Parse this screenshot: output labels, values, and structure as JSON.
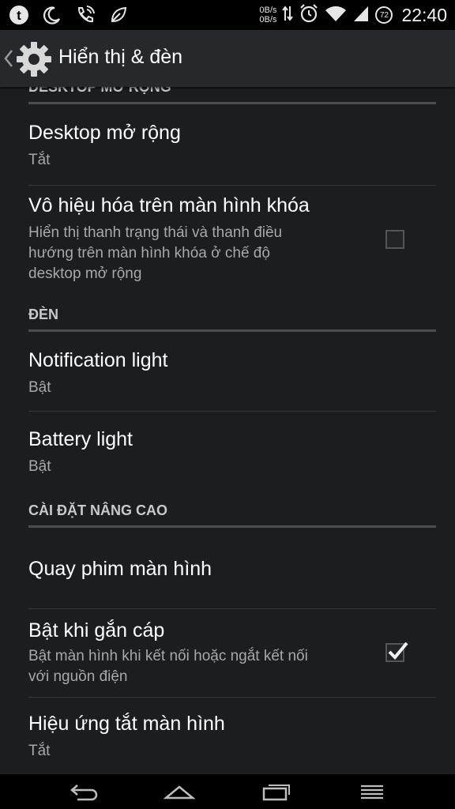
{
  "status_bar": {
    "icons_left": [
      "tumblr-icon",
      "moon-icon",
      "phone-call-icon",
      "leaf-icon"
    ],
    "net_up": "0B/s",
    "net_down": "0B/s",
    "battery_level": "72",
    "time": "22:40"
  },
  "action_bar": {
    "title": "Hiển thị & đèn"
  },
  "sections": {
    "partial_header": "DESKTOP MỞ RỘNG",
    "lights_header": "ĐÈN",
    "advanced_header": "CÀI ĐẶT NÂNG CAO"
  },
  "items": {
    "desktop": {
      "title": "Desktop mở rộng",
      "summary": "Tắt"
    },
    "lockscreen": {
      "title": "Vô hiệu hóa trên màn hình khóa",
      "summary_line1": "Hiển thị thanh trạng thái và thanh điều",
      "summary_line2": "hướng trên màn hình khóa ở chế độ",
      "summary_line3": "desktop mở rộng",
      "checked": false
    },
    "notification_light": {
      "title": "Notification light",
      "summary": "Bật"
    },
    "battery_light": {
      "title": "Battery light",
      "summary": "Bật"
    },
    "screen_record": {
      "title": "Quay phim màn hình"
    },
    "wake_plug": {
      "title": "Bật khi gắn cáp",
      "summary_line1": "Bật màn hình khi kết nối hoặc ngắt kết nối",
      "summary_line2": "với nguồn điện",
      "checked": true
    },
    "screen_off_anim": {
      "title": "Hiệu ứng tắt màn hình",
      "summary": "Tắt"
    }
  },
  "nav_bar": {
    "icons": [
      "back-icon",
      "home-icon",
      "recents-icon",
      "menu-icon"
    ]
  },
  "colors": {
    "background": "#1b1d20",
    "action_bar": "#26282b",
    "header_text": "#c9c9c9",
    "summary_text": "#a8a8a8",
    "divider": "#35373b"
  }
}
